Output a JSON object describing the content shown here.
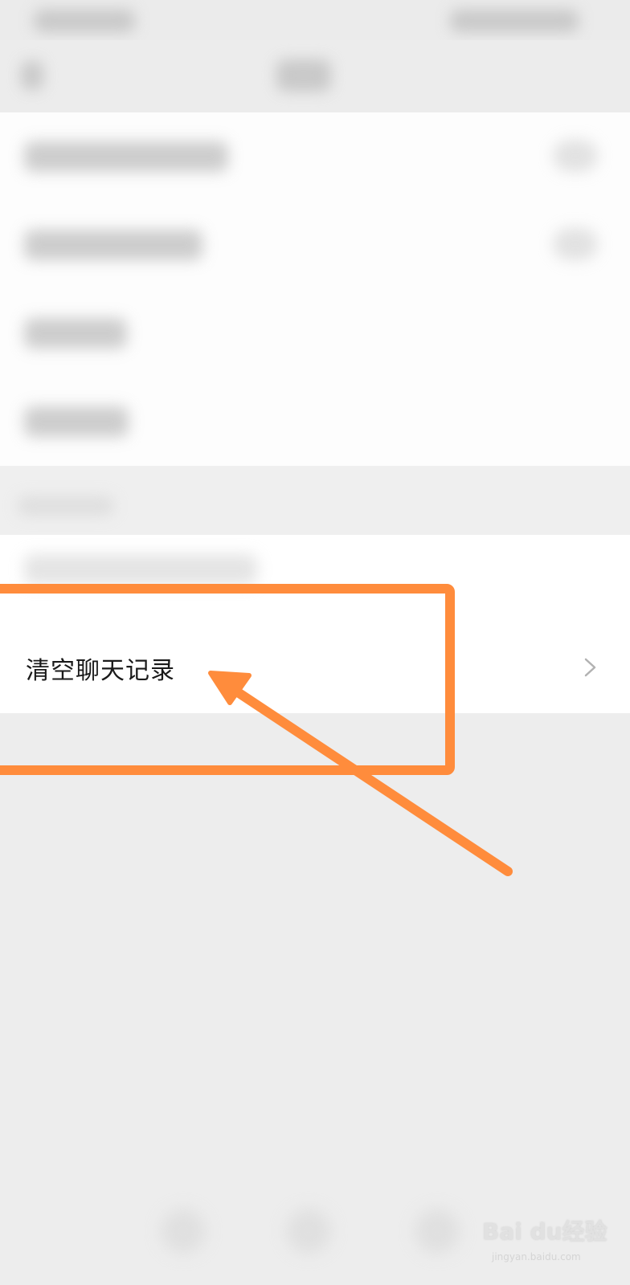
{
  "settings_list": {
    "clear_chat_history_label": "清空聊天记录"
  },
  "watermark": {
    "brand": "Bai du经验",
    "url": "jingyan.baidu.com"
  },
  "colors": {
    "highlight": "#ff8c3c",
    "page_background": "#ededed",
    "panel_background": "#ffffff"
  }
}
